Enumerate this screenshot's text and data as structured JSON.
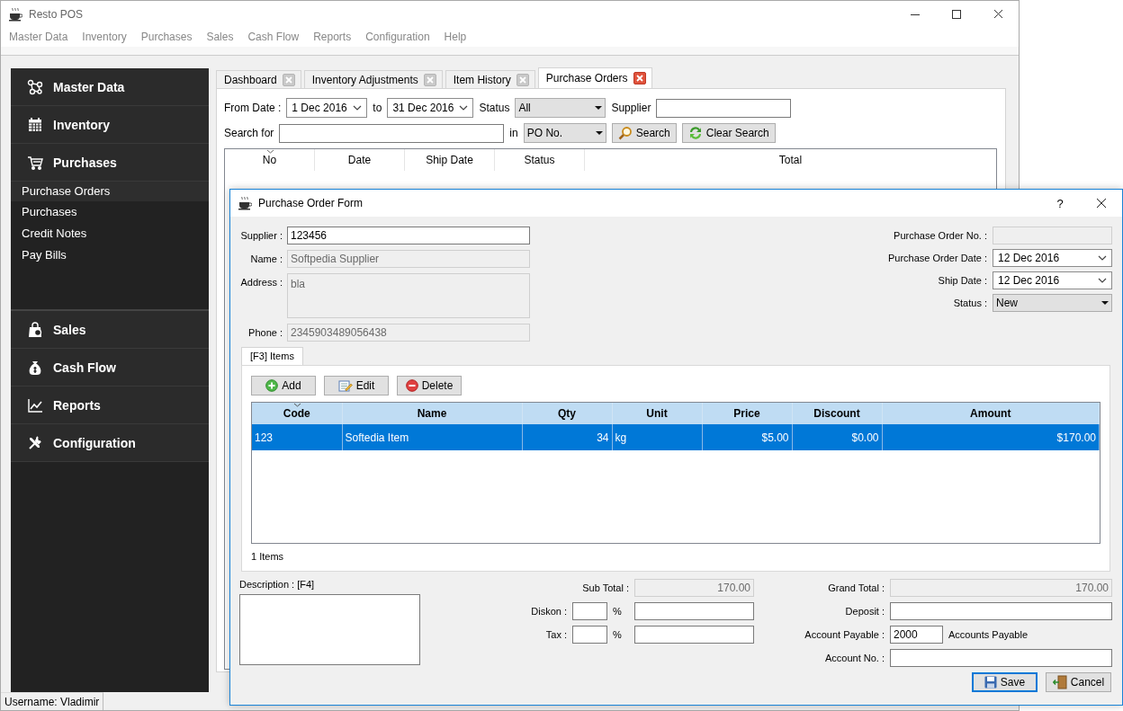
{
  "window": {
    "title": "Resto POS"
  },
  "menu": [
    "Master Data",
    "Inventory",
    "Purchases",
    "Sales",
    "Cash Flow",
    "Reports",
    "Configuration",
    "Help"
  ],
  "sidebar": [
    {
      "label": "Master Data"
    },
    {
      "label": "Inventory"
    },
    {
      "label": "Purchases",
      "items": [
        {
          "label": "Purchase Orders",
          "selected": true
        },
        {
          "label": "Purchases",
          "selected": false
        },
        {
          "label": "Credit Notes",
          "selected": false
        },
        {
          "label": "Pay Bills",
          "selected": false
        }
      ]
    },
    {
      "label": "Sales"
    },
    {
      "label": "Cash Flow"
    },
    {
      "label": "Reports"
    },
    {
      "label": "Configuration"
    }
  ],
  "tabs": [
    {
      "label": "Dashboard",
      "selected": false
    },
    {
      "label": "Inventory Adjustments",
      "selected": false
    },
    {
      "label": "Item History",
      "selected": false
    },
    {
      "label": "Purchase Orders",
      "selected": true
    }
  ],
  "filters": {
    "from_label": "From Date :",
    "from_date": "1 Dec 2016",
    "to_label": "to",
    "to_date": "31 Dec 2016",
    "status_label": "Status",
    "status": "All",
    "supplier_label": "Supplier",
    "search_label": "Search for",
    "in_label": "in",
    "search_in": "PO No."
  },
  "filter_buttons": [
    {
      "label": "Search",
      "kind": "search"
    },
    {
      "label": "Clear Search",
      "kind": "refresh"
    }
  ],
  "table": {
    "columns": [
      {
        "label": "No",
        "sorted": true
      },
      {
        "label": "Date",
        "sorted": false
      },
      {
        "label": "Ship Date",
        "sorted": false
      },
      {
        "label": "Status",
        "sorted": false
      },
      {
        "label": "Total",
        "sorted": false
      }
    ]
  },
  "status_bar": "Username: Vladimir",
  "dialog": {
    "title": "Purchase Order Form",
    "help": "?",
    "left_fields": [
      {
        "label": "Supplier :",
        "kind": "text",
        "value": "123456",
        "disabled": false
      },
      {
        "label": "Name :",
        "kind": "text",
        "value": "Softpedia Supplier",
        "disabled": true
      },
      {
        "label": "Address :",
        "kind": "textarea",
        "value": "bla",
        "disabled": true
      },
      {
        "label": "Phone :",
        "kind": "text",
        "value": "2345903489056438",
        "disabled": true
      }
    ],
    "right_fields": [
      {
        "label": "Purchase Order No. :",
        "kind": "text",
        "disabled": true
      },
      {
        "label": "Purchase Order Date :",
        "kind": "date",
        "value": "12 Dec 2016",
        "disabled": false
      },
      {
        "label": "Ship Date :",
        "kind": "date",
        "value": "12 Dec 2016",
        "disabled": false
      },
      {
        "label": "Status :",
        "kind": "combo",
        "value": "New",
        "disabled": false
      }
    ],
    "tabs": [
      {
        "label": "[F3] Items",
        "selected": true
      }
    ],
    "actions": [
      {
        "label": "Add",
        "kind": "add"
      },
      {
        "label": "Edit",
        "kind": "edit"
      },
      {
        "label": "Delete",
        "kind": "delete"
      }
    ],
    "table": {
      "columns": [
        {
          "label": "Code",
          "kind": "text",
          "sorted": true
        },
        {
          "label": "Name",
          "kind": "text",
          "sorted": false
        },
        {
          "label": "Qty",
          "kind": "number",
          "sorted": false
        },
        {
          "label": "Unit",
          "kind": "text",
          "sorted": false
        },
        {
          "label": "Price",
          "kind": "number",
          "sorted": false
        },
        {
          "label": "Discount",
          "kind": "number",
          "sorted": false
        },
        {
          "label": "Amount",
          "kind": "number",
          "sorted": false
        }
      ],
      "rows": [
        {
          "cells": [
            "123",
            "Softedia Item",
            "34",
            "kg",
            "$5.00",
            "$0.00",
            "$170.00"
          ],
          "selected": true
        }
      ]
    },
    "count": "1 Items",
    "description": {
      "label": "Description : [F4]"
    },
    "totals": [
      {
        "label": "Sub Total :",
        "kind": "amount",
        "value": "170.00"
      },
      {
        "label": "Diskon :",
        "kind": "percent",
        "symbol": "%"
      },
      {
        "label": "Tax :",
        "kind": "percent",
        "symbol": "%"
      }
    ],
    "payment": [
      {
        "label": "Grand Total :",
        "kind": "amount",
        "value": "170.00"
      },
      {
        "label": "Deposit :",
        "kind": "input"
      },
      {
        "label": "Account Payable :",
        "kind": "account",
        "value": "2000",
        "note": "Accounts Payable"
      },
      {
        "label": "Account No. :",
        "kind": "input"
      }
    ],
    "buttons": [
      {
        "label": "Save",
        "kind": "save",
        "default": true
      },
      {
        "label": "Cancel",
        "kind": "cancel",
        "default": false
      }
    ]
  }
}
